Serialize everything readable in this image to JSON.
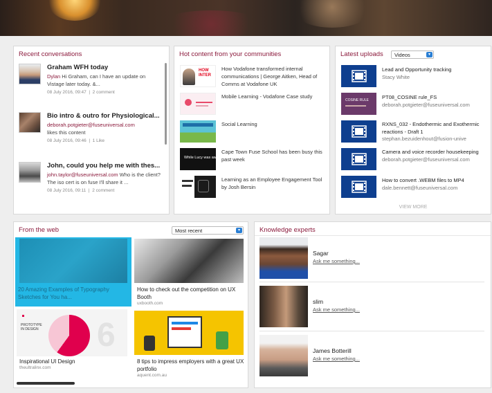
{
  "colors": {
    "accent": "#8b1a3c",
    "video_blue": "#0e3f8f",
    "highlight": "#23b7e5"
  },
  "recent_conversations": {
    "title": "Recent conversations",
    "items": [
      {
        "title": "Graham WFH today",
        "who": "Dylan",
        "text": " Hi Graham, can I have an update on Vistage later today. &...",
        "date": "08 July 2016, 09:47",
        "action": "2 comment"
      },
      {
        "title": "Bio intro & outro for Physiological...",
        "who": "deborah.potgieter@fuseuniversal.com",
        "text": " likes this content",
        "date": "08 July 2016, 09:46",
        "action": "1 Like"
      },
      {
        "title": "John, could you help me with thes...",
        "who": "john.taylor@fuseuniversal.com",
        "text": " Who is the client? The iso cert is on fuse I'll share it ...",
        "date": "08 July 2016, 09:11",
        "action": "2 comment"
      }
    ]
  },
  "hot_content": {
    "title": "Hot content from your communities",
    "items": [
      {
        "text": "How Vodafone transformed internal communications | George Aitken, Head of Comms at Vodafone UK"
      },
      {
        "text": "Mobile Learning - Vodafone Case study"
      },
      {
        "text": "Social Learning"
      },
      {
        "text": "Cape Town Fuse School has been busy this past week",
        "thumb_text": "While Lucy was away..."
      },
      {
        "text": "Learning as an Employee Engagement Tool by Josh Bersin"
      }
    ]
  },
  "latest_uploads": {
    "title": "Latest uploads",
    "filter_value": "Videos",
    "items": [
      {
        "title": "Lead and Opportunity tracking",
        "user": "Stacy White",
        "icon": "film-icon"
      },
      {
        "title": "PT08_COSINE rule_FS",
        "user": "deborah.potgieter@fuseuniversal.com",
        "icon": "presentation-thumbnail",
        "thumb_text": "COSINE RULE"
      },
      {
        "title": "RXNS_032 - Endothermic and Exothermic reactions - Draft 1",
        "user": "stephan.bezuidenhout@fusion-unive",
        "icon": "film-icon"
      },
      {
        "title": "Camera and voice recorder housekeeping",
        "user": "deborah.potgieter@fuseuniversal.com",
        "icon": "film-icon"
      },
      {
        "title": "How to convert .WEBM files to MP4",
        "user": "dale.bennett@fuseuniversal.com",
        "icon": "film-icon"
      }
    ],
    "view_more": "VIEW MORE"
  },
  "from_the_web": {
    "title": "From the web",
    "sort_value": "Most recent",
    "items": [
      {
        "caption": "20 Amazing Examples of Typography Sketches for You ha...",
        "source": "",
        "highlighted": true
      },
      {
        "caption": "How to check out the competition on UX Booth",
        "source": "uxbooth.com"
      },
      {
        "caption": "Inspirational UI Design",
        "source": "theultralinx.com",
        "thumb_text": "PROTOTYPE IN DESIGN"
      },
      {
        "caption": "8 tips to impress employers with a great UX portfolio",
        "source": "aquent.com.au"
      }
    ]
  },
  "knowledge_experts": {
    "title": "Knowledge experts",
    "items": [
      {
        "name": "Sagar",
        "ask": "Ask me something..."
      },
      {
        "name": "slim",
        "ask": "Ask me something..."
      },
      {
        "name": "James Botterill",
        "ask": "Ask me something..."
      }
    ]
  }
}
